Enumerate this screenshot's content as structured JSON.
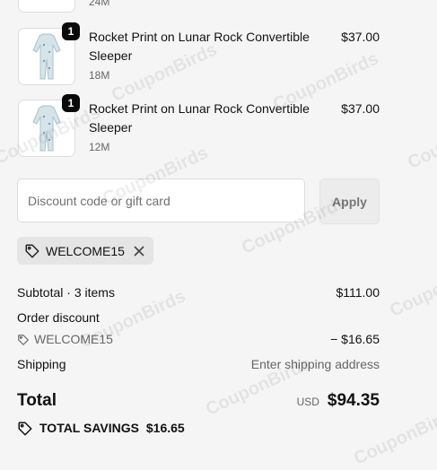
{
  "items": [
    {
      "name": "Rocket Print on Lunar Rock Convertible Sleeper",
      "variant": "18M",
      "price": "$37.00",
      "quantity": "1"
    },
    {
      "name": "Rocket Print on Lunar Rock Convertible Sleeper",
      "variant": "12M",
      "price": "$37.00",
      "quantity": "1"
    }
  ],
  "partial_item_variant": "24M",
  "discount": {
    "placeholder": "Discount code or gift card",
    "apply_label": "Apply"
  },
  "applied_code": {
    "label": "WELCOME15"
  },
  "summary": {
    "subtotal_label": "Subtotal · 3 items",
    "subtotal_value": "$111.00",
    "order_discount_label": "Order discount",
    "discount_code": "WELCOME15",
    "discount_value": "− $16.65",
    "shipping_label": "Shipping",
    "shipping_value": "Enter shipping address",
    "total_label": "Total",
    "currency": "USD",
    "total_value": "$94.35",
    "savings_label": "TOTAL SAVINGS",
    "savings_value": "$16.65"
  },
  "watermark": "CouponBirds",
  "colors": {
    "background": "#f5f5f5",
    "badge": "#0a0a0a",
    "tag": "#e5e5e5"
  }
}
